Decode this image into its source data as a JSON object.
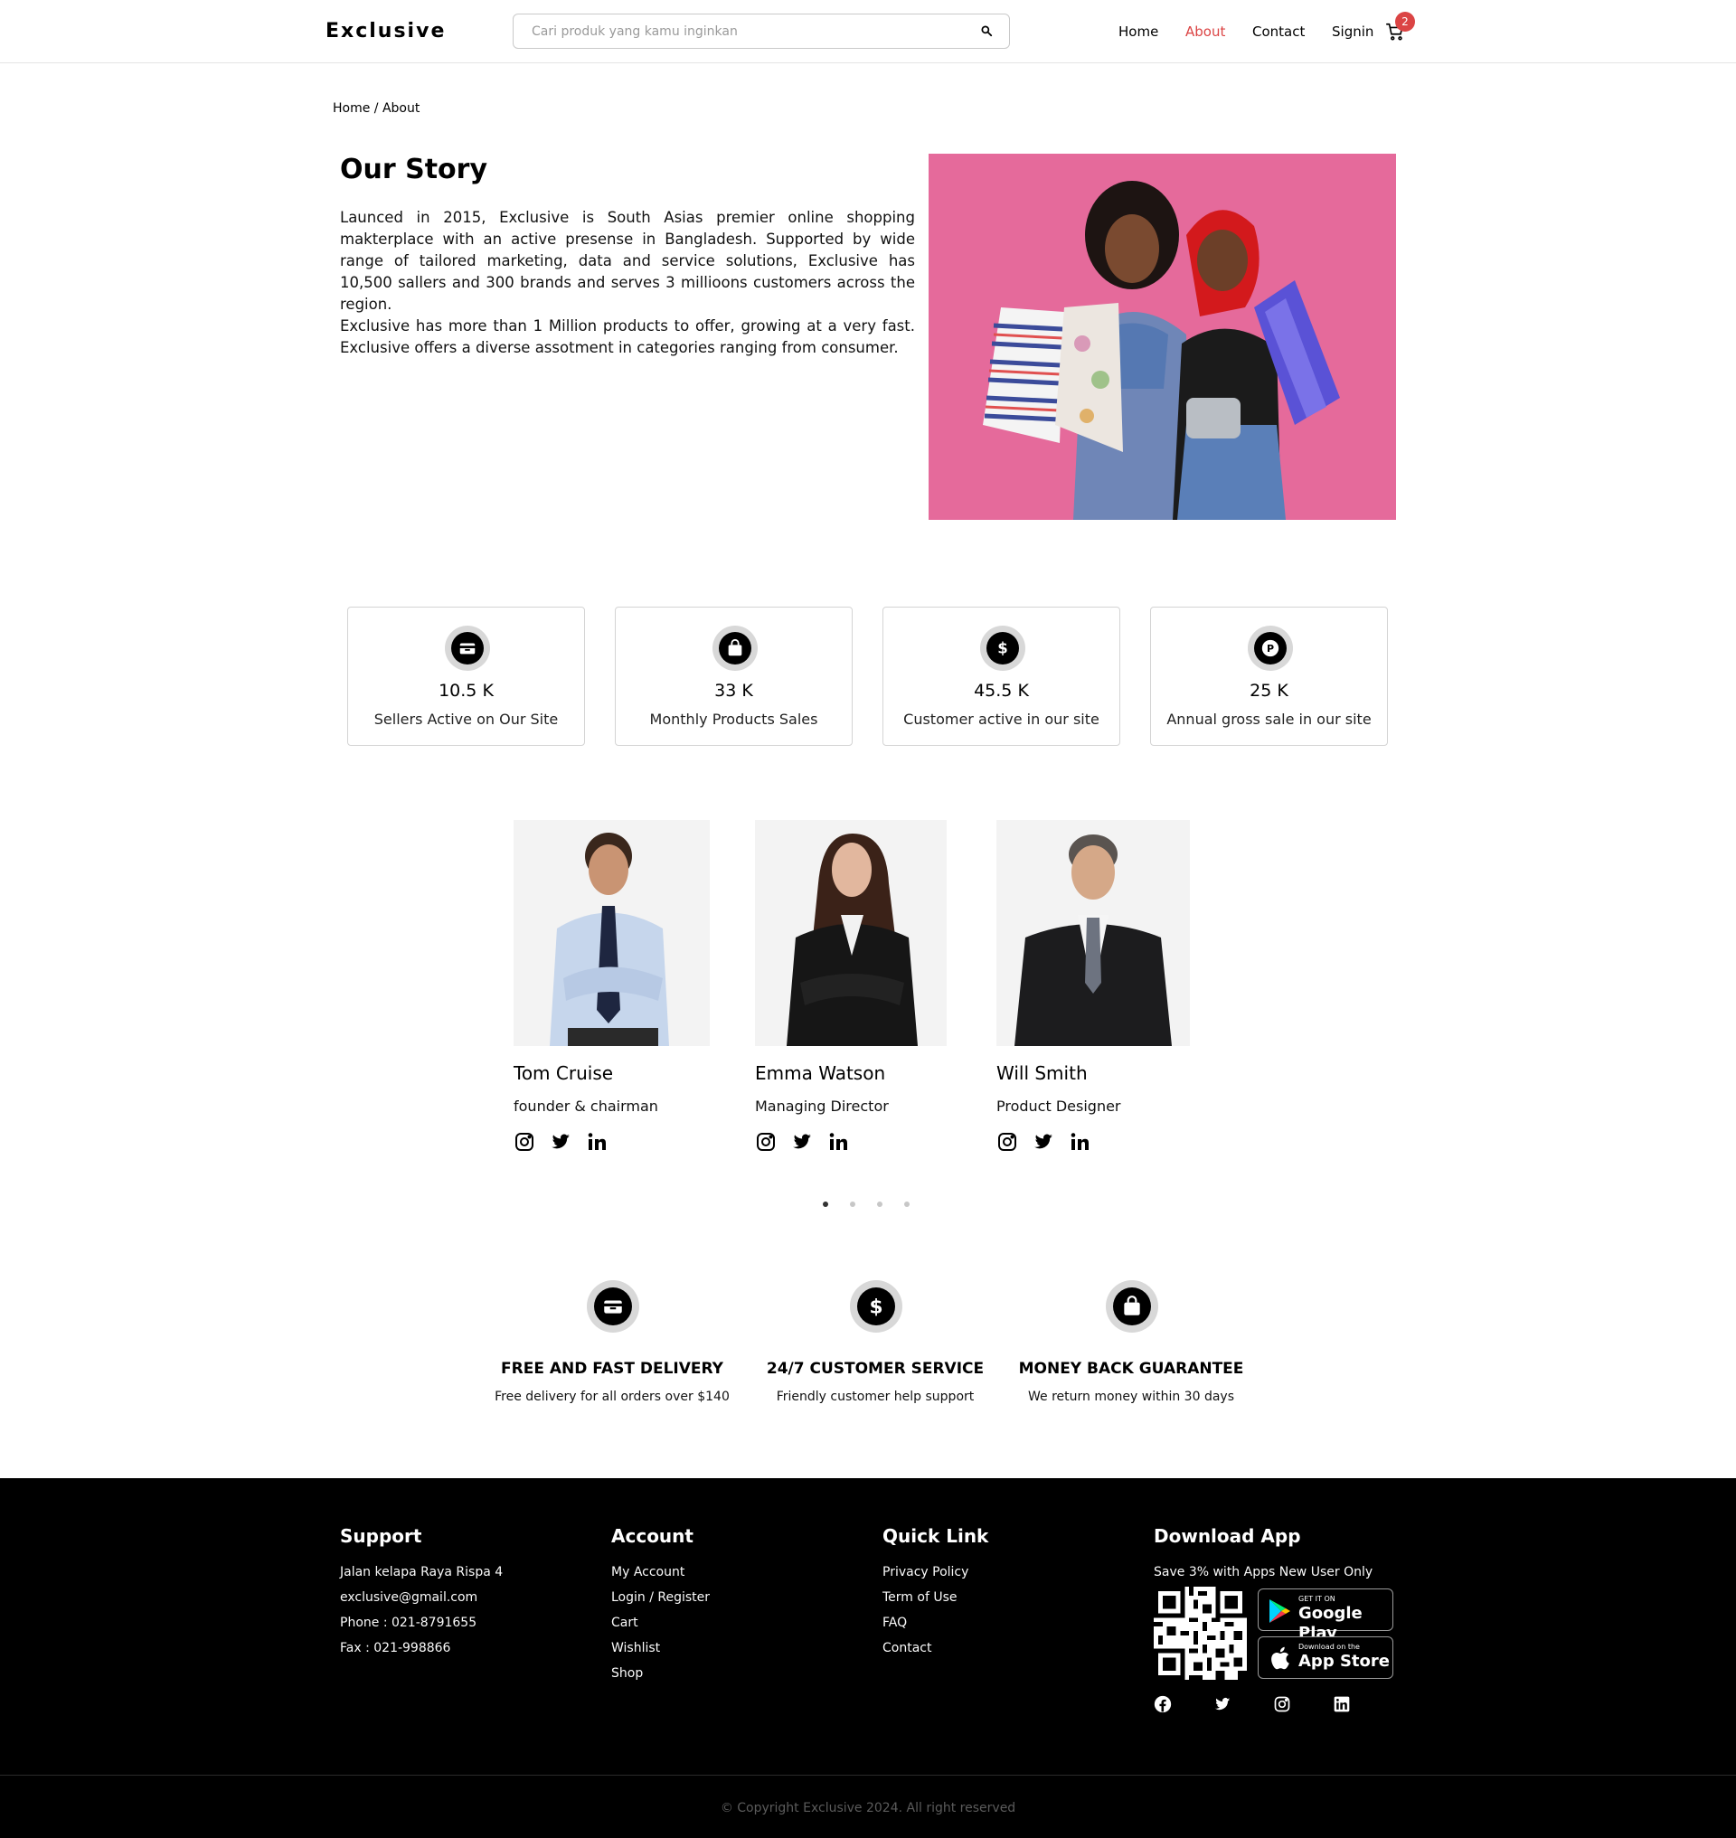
{
  "header": {
    "logo": "Exclusive",
    "search_placeholder": "Cari produk yang kamu inginkan",
    "nav": {
      "home": "Home",
      "about": "About",
      "contact": "Contact",
      "signin": "Signin"
    },
    "cart_count": "2",
    "accent_color": "#DB4444"
  },
  "breadcrumb": "Home / About",
  "story": {
    "title": "Our Story",
    "p1": "Launced in 2015, Exclusive is South Asias premier online shopping makterplace with an active presense in Bangladesh. Supported by wide range of tailored marketing, data and service solutions, Exclusive has 10,500 sallers and 300 brands and serves 3 millioons customers across the region.",
    "p2": "Exclusive has more than 1 Million products to offer, growing at a very fast. Exclusive offers a diverse assotment in categories ranging from consumer."
  },
  "stats": [
    {
      "value": "10.5 K",
      "label": "Sellers Active on Our Site",
      "icon": "shop-icon"
    },
    {
      "value": "33 K",
      "label": "Monthly Products Sales",
      "icon": "shopping-bag-icon"
    },
    {
      "value": "45.5 K",
      "label": "Customer active in our site",
      "icon": "dollar-icon"
    },
    {
      "value": "25 K",
      "label": "Annual gross sale in our site",
      "icon": "coin-icon"
    }
  ],
  "team": [
    {
      "name": "Tom Cruise",
      "role": "founder & chairman"
    },
    {
      "name": "Emma Watson",
      "role": "Managing Director"
    },
    {
      "name": "Will Smith",
      "role": "Product Designer"
    }
  ],
  "carousel": {
    "pages": 4,
    "active": 1
  },
  "services": [
    {
      "title": "FREE AND FAST DELIVERY",
      "desc": "Free delivery for all orders over $140",
      "icon": "delivery-icon"
    },
    {
      "title": "24/7 CUSTOMER SERVICE",
      "desc": "Friendly customer help support",
      "icon": "dollar-icon"
    },
    {
      "title": "MONEY BACK GUARANTEE",
      "desc": "We return money within 30 days",
      "icon": "shopping-bag-icon"
    }
  ],
  "footer": {
    "support": {
      "title": "Support",
      "items": [
        "Jalan kelapa Raya Rispa 4",
        "exclusive@gmail.com",
        "Phone : 021-8791655",
        "Fax : 021-998866"
      ]
    },
    "account": {
      "title": "Account",
      "items": [
        "My Account",
        "Login / Register",
        "Cart",
        "Wishlist",
        "Shop"
      ]
    },
    "quick": {
      "title": "Quick Link",
      "items": [
        "Privacy Policy",
        "Term of Use",
        "FAQ",
        "Contact"
      ]
    },
    "app": {
      "title": "Download App",
      "subtitle": "Save 3% with Apps New User Only",
      "google_small": "GET IT ON",
      "google_big": "Google Play",
      "apple_small": "Download on the",
      "apple_big": "App Store"
    },
    "copyright": "© Copyright Exclusive 2024. All right reserved"
  }
}
